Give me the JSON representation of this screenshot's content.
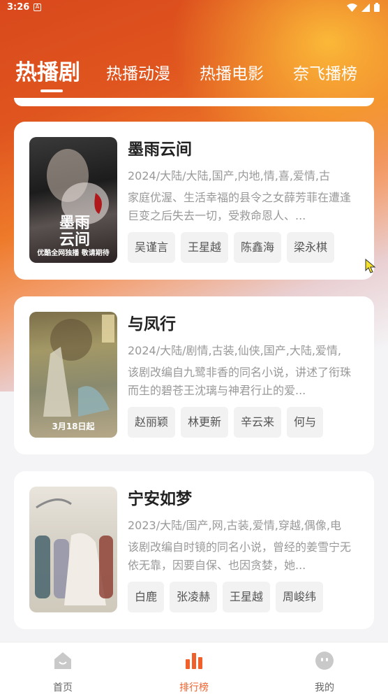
{
  "status": {
    "time": "3:26",
    "badge": "A"
  },
  "tabs": [
    {
      "label": "热播剧",
      "active": true
    },
    {
      "label": "热播动漫",
      "active": false
    },
    {
      "label": "热播电影",
      "active": false
    },
    {
      "label": "奈飞播榜",
      "active": false
    }
  ],
  "cards": [
    {
      "title": "墨雨云间",
      "meta": "2024/大陆/大陆,国产,内地,情,喜,爱情,古",
      "desc": "家庭优渥、生活幸福的县令之女薛芳菲在遭逢巨变之后失去一切，受救命恩人、...",
      "poster_title": "墨雨云间",
      "poster_caption": "优酷全网独播 敬请期待",
      "actors": [
        "吴谨言",
        "王星越",
        "陈鑫海",
        "梁永棋"
      ]
    },
    {
      "title": "与凤行",
      "meta": "2024/大陆/剧情,古装,仙侠,国产,大陆,爱情,",
      "desc": "该剧改编自九鹭非香的同名小说，讲述了衔珠而生的碧苍王沈璃与神君行止的爱...",
      "poster_title": "",
      "poster_caption": "3月18日起",
      "actors": [
        "赵丽颖",
        "林更新",
        "辛云来",
        "何与"
      ]
    },
    {
      "title": "宁安如梦",
      "meta": "2023/大陆/国产,网,古装,爱情,穿越,偶像,电",
      "desc": "该剧改编自时镜的同名小说，曾经的姜雪宁无依无靠，因要自保、也因贪婪，她...",
      "poster_title": "",
      "poster_caption": "",
      "actors": [
        "白鹿",
        "张凌赫",
        "王星越",
        "周峻纬"
      ]
    }
  ],
  "nav": [
    {
      "label": "首页",
      "icon": "home-icon",
      "active": false
    },
    {
      "label": "排行榜",
      "icon": "ranking-icon",
      "active": true
    },
    {
      "label": "我的",
      "icon": "profile-icon",
      "active": false
    }
  ],
  "colors": {
    "accent": "#f0602a",
    "header_top": "#d9481c"
  }
}
